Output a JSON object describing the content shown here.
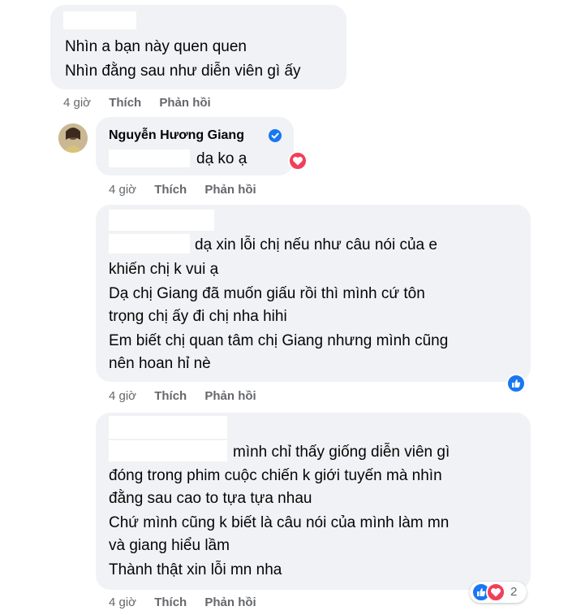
{
  "comments": [
    {
      "lines": [
        "Nhìn a bạn này quen quen",
        "Nhìn đằng sau như diễn viên gì ấy"
      ],
      "time": "4 giờ",
      "like": "Thích",
      "reply": "Phản hồi"
    },
    {
      "author": "Nguyễn Hương Giang",
      "lines": [
        "dạ ko ạ"
      ],
      "time": "4 giờ",
      "like": "Thích",
      "reply": "Phản hồi",
      "reactions": [
        "love"
      ]
    },
    {
      "lines": [
        "dạ xin lỗi chị nếu như câu nói của e",
        "khiến chị k vui ạ",
        "Dạ chị Giang đã muốn giấu rồi thì mình cứ tôn",
        "trọng chị ấy đi chị nha hihi",
        "Em biết chị quan tâm chị Giang nhưng mình cũng",
        "nên hoan hỉ nè"
      ],
      "time": "4 giờ",
      "like": "Thích",
      "reply": "Phản hồi",
      "reactions": [
        "like"
      ]
    },
    {
      "lines": [
        "mình chỉ thấy giống diễn viên gì",
        "đóng trong phim cuộc chiến k giới tuyến mà nhìn",
        "đằng sau cao to tựa tựa nhau",
        "Chứ mình cũng k biết là câu nói của mình làm mn",
        "và giang hiểu lầm",
        "Thành thật xin lỗi mn nha"
      ],
      "time": "4 giờ",
      "like": "Thích",
      "reply": "Phản hồi",
      "reactions": [
        "like",
        "love"
      ],
      "reaction_count": "2"
    }
  ],
  "colors": {
    "like": "#1877f2",
    "love": "#f33e58",
    "bubble": "#f0f2f5",
    "meta": "#65676b"
  },
  "icons": {
    "verified": "verified-badge-icon",
    "like": "like-thumb-icon",
    "love": "love-heart-icon"
  }
}
